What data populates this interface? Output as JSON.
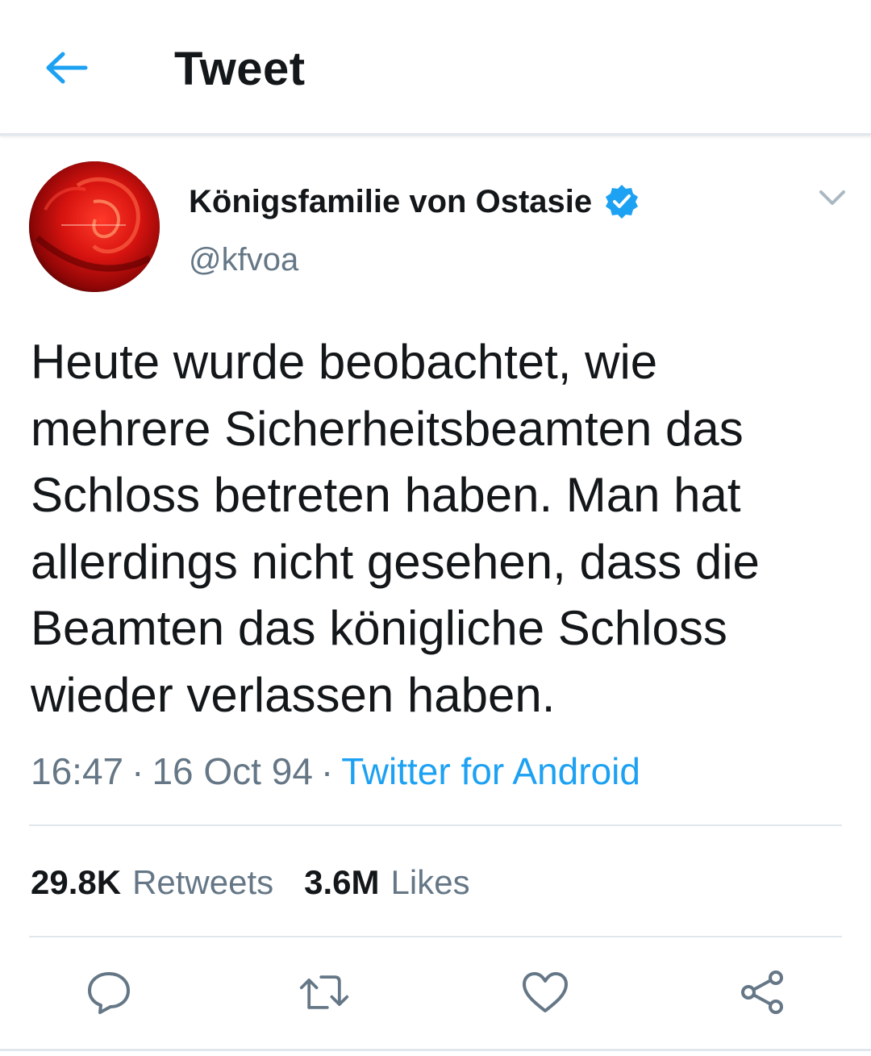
{
  "header": {
    "title": "Tweet",
    "back_icon": "arrow-left-icon"
  },
  "tweet": {
    "author": {
      "display_name": "Königsfamilie von Ostasie",
      "handle": "@kfvoa",
      "verified_icon": "verified-badge-icon"
    },
    "text": "Heute wurde beobachtet, wie\nmehrere Sicherheitsbeamten das\nSchloss betreten haben. Man hat\nallerdings nicht gesehen, dass die\nBeamten das königliche Schloss\nwieder verlassen haben.",
    "time": "16:47",
    "date": "16 Oct 94",
    "separator": "·",
    "source": "Twitter for Android",
    "stats": {
      "retweets_count": "29.8K",
      "retweets_label": "Retweets",
      "likes_count": "3.6M",
      "likes_label": "Likes"
    },
    "actions": [
      "reply-icon",
      "retweet-icon",
      "like-icon",
      "share-icon"
    ]
  },
  "colors": {
    "accent": "#1da1f2",
    "text": "#14171a",
    "secondary": "#657786",
    "divider": "#e1e8ed"
  }
}
